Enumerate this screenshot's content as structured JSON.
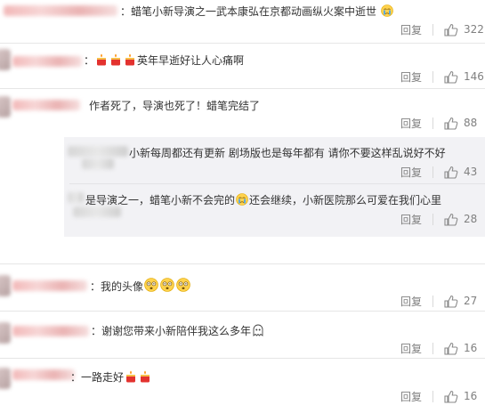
{
  "comments": [
    {
      "text": "：蜡笔小新导演之一武本康弘在京都动画纵火案中逝世",
      "emoji": "crying-emoji",
      "reply": "回复",
      "likes": "322"
    },
    {
      "text": "英年早逝好让人心痛啊",
      "emoji": "candle-emoji",
      "reply": "回复",
      "likes": "146"
    },
    {
      "text": "作者死了，导演也死了！蜡笔完结了",
      "reply": "回复",
      "likes": "88"
    },
    {
      "text": "：我的头像",
      "emoji": "dazed-face-emoji",
      "reply": "回复",
      "likes": "27"
    },
    {
      "text": "：谢谢您带来小新陪伴我这么多年",
      "emoji": "ghost-face-emoji",
      "reply": "回复",
      "likes": "16"
    },
    {
      "text": "：一路走好",
      "emoji": "candle-emoji",
      "reply": "回复",
      "likes": "16"
    }
  ],
  "replies": [
    {
      "text": "小新每周都还有更新  剧场版也是每年都有 请你不要这样乱说好不好",
      "reply": "回复",
      "likes": "43"
    },
    {
      "text_before": "是导演之一，蜡笔小新不会完的",
      "emoji": "crying-emoji",
      "text_after": "还会继续，小新医院那么可爱在我们心里",
      "reply": "回复",
      "likes": "28"
    }
  ],
  "colors": {
    "action_gray": "#808080",
    "text": "#333333",
    "sub_bg": "#f2f2f5"
  }
}
